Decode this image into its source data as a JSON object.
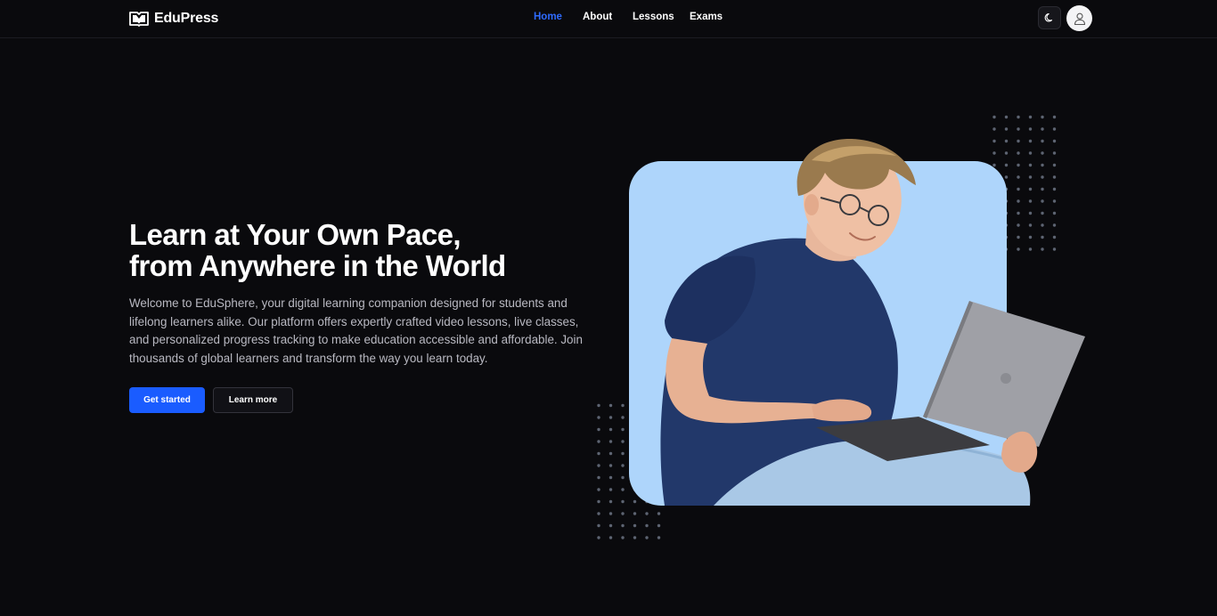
{
  "header": {
    "brand": "EduPress",
    "nav": [
      "Home",
      "About",
      "Lessons",
      "Exams"
    ],
    "active": "Home"
  },
  "hero": {
    "title_line1": "Learn at Your Own Pace,",
    "title_line2": "from Anywhere in the World",
    "description": "Welcome to EduSphere, your digital learning companion designed for students and lifelong learners alike. Our platform offers expertly crafted video lessons, live classes, and personalized progress tracking to make education accessible and affordable. Join thousands of global learners and transform the way you learn today.",
    "primary_button": "Get started",
    "secondary_button": "Learn more"
  },
  "icons": {
    "logo": "open-book-icon",
    "theme_toggle": "moon-icon",
    "user": "user-icon"
  },
  "colors": {
    "background": "#0a0a0d",
    "accent": "#1a5cff",
    "active_link": "#2f6bff",
    "card": "#aed5fb"
  }
}
